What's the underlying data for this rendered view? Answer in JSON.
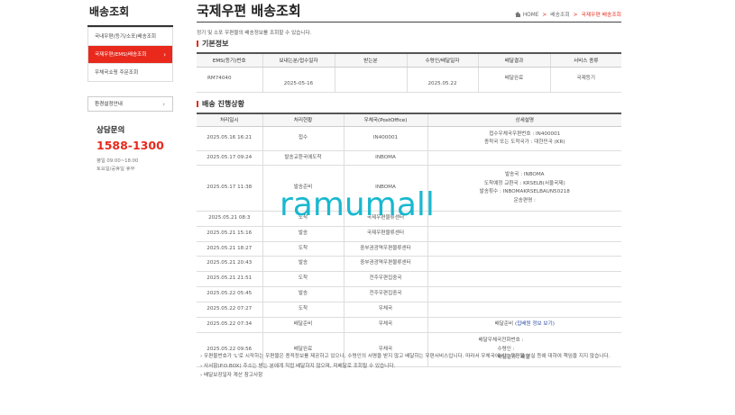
{
  "sidebar": {
    "title": "배송조회",
    "items": [
      {
        "label": "국내우편(등기/소포)배송조회"
      },
      {
        "label": "국제우편(EMS)배송조회"
      },
      {
        "label": "우체국쇼핑 주문조회"
      }
    ],
    "env_label": "환경설정안내",
    "cs_title": "상담문의",
    "cs_phone": "1588-1300",
    "cs_hours_1": "평일 09:00~18:00",
    "cs_hours_2": "토요일/공휴일 휴무"
  },
  "header": {
    "title": "국제우편 배송조회",
    "breadcrumb": [
      "HOME",
      "배송조회",
      "국제우편 배송조회"
    ]
  },
  "intro": "정기 및 소포 우편물의 배송정보를 조회할 수 있습니다.",
  "basic": {
    "title": "기본정보",
    "headers": [
      "EMS(등기)번호",
      "보내는분/접수일자",
      "받는분",
      "수령인/배달일자",
      "배달결과",
      "서비스 종류"
    ],
    "row": [
      "RM74040",
      "2025-05-16",
      "",
      "2025.05.22",
      "배달완료",
      "국제등기"
    ]
  },
  "progress": {
    "title": "배송 진행상황",
    "headers": [
      "처리일시",
      "처리현황",
      "우체국(PostOffice)",
      "상세설명"
    ],
    "rows": [
      {
        "date": "2025.05.16 16:21",
        "status": "접수",
        "office": "IN400001",
        "detail": [
          "접수우체국우편번호 : IN400001",
          "종착국 또는 도착국가 : 대한민국 (KR)"
        ]
      },
      {
        "date": "2025.05.17 09:24",
        "status": "발송교환국에도착",
        "office": "INBOMA",
        "detail": []
      },
      {
        "date": "2025.05.17 11:38",
        "status": "발송준비",
        "office": "INBOMA",
        "detail": [
          "발송국 : INBOMA",
          "도착예정 교환국 : KRSELB(서울국제)",
          "발송횟수 : INBOMAKRSELBAUN50218",
          "운송편명 :"
        ]
      },
      {
        "date": "2025.05.21 08:3",
        "status": "도착",
        "office": "국제우편물류센터",
        "detail": []
      },
      {
        "date": "2025.05.21 15:16",
        "status": "발송",
        "office": "국제우편물류센터",
        "detail": []
      },
      {
        "date": "2025.05.21 18:27",
        "status": "도착",
        "office": "중부권광역우편물류센터",
        "detail": []
      },
      {
        "date": "2025.05.21 20:43",
        "status": "발송",
        "office": "중부권광역우편물류센터",
        "detail": []
      },
      {
        "date": "2025.05.21 21:51",
        "status": "도착",
        "office": "전주우편집중국",
        "detail": []
      },
      {
        "date": "2025.05.22 05:45",
        "status": "발송",
        "office": "전주우편집중국",
        "detail": []
      },
      {
        "date": "2025.05.22 07:27",
        "status": "도착",
        "office": "우체국",
        "detail": []
      },
      {
        "date": "2025.05.22 07:34",
        "status": "배달준비",
        "office": "우체국",
        "detail_prefix": "배달준비 ",
        "detail_link": "(집배원 정보 보기)"
      },
      {
        "date": "2025.05.22 09:56",
        "status": "배달완료",
        "office": "우체국",
        "detail": [
          "배달우체국전화번호 :",
          "수령인 :",
          "배달결과 : 배달"
        ]
      }
    ]
  },
  "notes": [
    "우편물번호가 'L'로 시작하는 우편물은 종적정보를 제공하고 있으나, 수령인의 서명을 받지 않고 배달하는 우편서비스입니다. 따라서 우체국에서는 우편물 분실 등에 대하여 책임을 지지 않습니다.",
    "사서함(P.O.BOX) 주소는 받는 분에게 직접 배달하지 않으며, 미배달로 조회될 수 있습니다.",
    "배달보장일자 계산 참고사항"
  ],
  "watermark": "ramumall",
  "colors": {
    "accent": "#e8291c",
    "watermark": "#19b8cf"
  }
}
